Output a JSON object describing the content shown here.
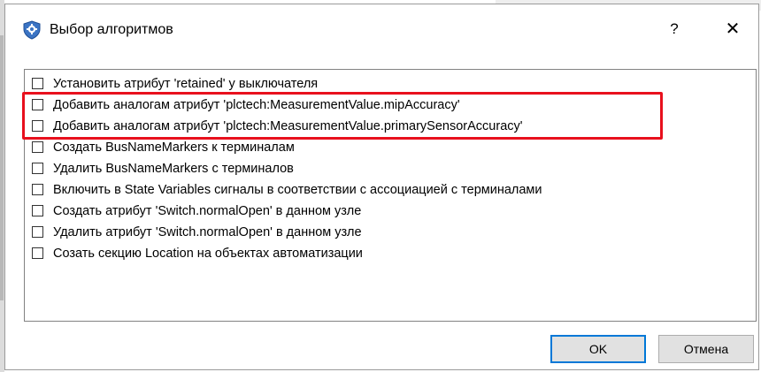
{
  "window": {
    "title": "Выбор алгоритмов",
    "help_label": "?",
    "close_label": "✕"
  },
  "algorithms": [
    {
      "label": "Установить атрибут 'retained' у выключателя",
      "checked": false
    },
    {
      "label": "Добавить аналогам атрибут 'plctech:MeasurementValue.mipAccuracy'",
      "checked": false
    },
    {
      "label": "Добавить аналогам атрибут 'plctech:MeasurementValue.primarySensorAccuracy'",
      "checked": false
    },
    {
      "label": "Создать BusNameMarkers к терминалам",
      "checked": false
    },
    {
      "label": "Удалить BusNameMarkers с терминалов",
      "checked": false
    },
    {
      "label": "Включить в State Variables сигналы в соответствии с ассоциацией с терминалами",
      "checked": false
    },
    {
      "label": "Создать атрибут 'Switch.normalOpen' в данном узле",
      "checked": false
    },
    {
      "label": "Удалить атрибут 'Switch.normalOpen' в данном узле",
      "checked": false
    },
    {
      "label": "Созать секцию Location на объектах автоматизации",
      "checked": false
    }
  ],
  "buttons": {
    "ok_label": "OK",
    "cancel_label": "Отмена"
  },
  "colors": {
    "highlight": "#e8101d",
    "default_button_border": "#0078d7",
    "button_face": "#e1e1e1"
  },
  "icons": {
    "app_icon": "shield-gear-icon"
  }
}
